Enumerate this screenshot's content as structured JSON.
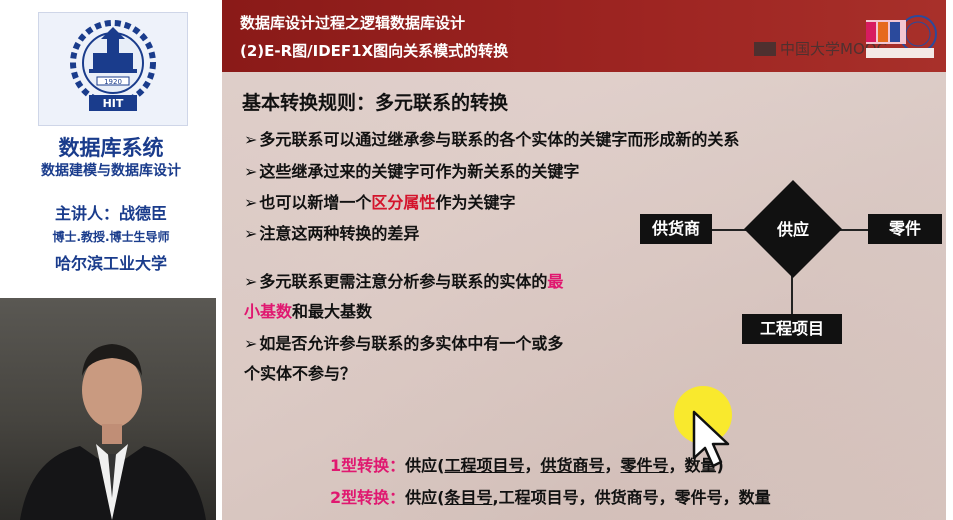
{
  "left_panel": {
    "logo_year": "1920",
    "logo_text": "HIT",
    "course_title": "数据库系统",
    "course_subtitle": "数据建模与数据库设计",
    "lecturer": "主讲人：战德臣",
    "lecturer_title": "博士.教授.博士生导师",
    "university": "哈尔滨工业大学"
  },
  "slide": {
    "header_line1": "数据库设计过程之逻辑数据库设计",
    "header_line2": "(2)E-R图/IDEF1X图向关系模式的转换",
    "watermark": "中国大学MOOC",
    "rule_title": "基本转换规则：多元联系的转换",
    "arrow": "➢",
    "bullet1": "多元联系可以通过继承参与联系的各个实体的关键字而形成新的关系",
    "bullet2": "这些继承过来的关键字可作为新关系的关键字",
    "bullet3_pre": "也可以新增一个",
    "bullet3_red": "区分属性",
    "bullet3_post": "作为关键字",
    "bullet4": "注意这两种转换的差异",
    "bullet5_pre": "多元联系更需注意分析参与联系的实体的",
    "bullet5_red": "最",
    "bullet5_line2_red": "小基数",
    "bullet5_line2_post": "和最大基数",
    "bullet6_line1": "如是否允许参与联系的多实体中有一个或多",
    "bullet6_line2": "个实体不参与？",
    "diagram": {
      "entity_left": "供货商",
      "relationship": "供应",
      "entity_right": "零件",
      "entity_bottom": "工程项目"
    },
    "type1": {
      "label": "1型转换：",
      "rel": "供应(",
      "k1": "工程项目号",
      "sep1": "，",
      "k2": "供货商号",
      "sep2": "，",
      "k3": "零件号",
      "rest": "，数量)"
    },
    "type2": {
      "label": "2型转换：",
      "rel": "供应(",
      "k1": "条目号",
      "rest": ",工程项目号，供货商号，零件号，数量"
    }
  },
  "colors": {
    "header_red": "#9e2522",
    "course_blue": "#1a3c8c",
    "highlight_red": "#d4142c",
    "highlight_magenta": "#e01870",
    "cursor_yellow": "#fff014"
  }
}
